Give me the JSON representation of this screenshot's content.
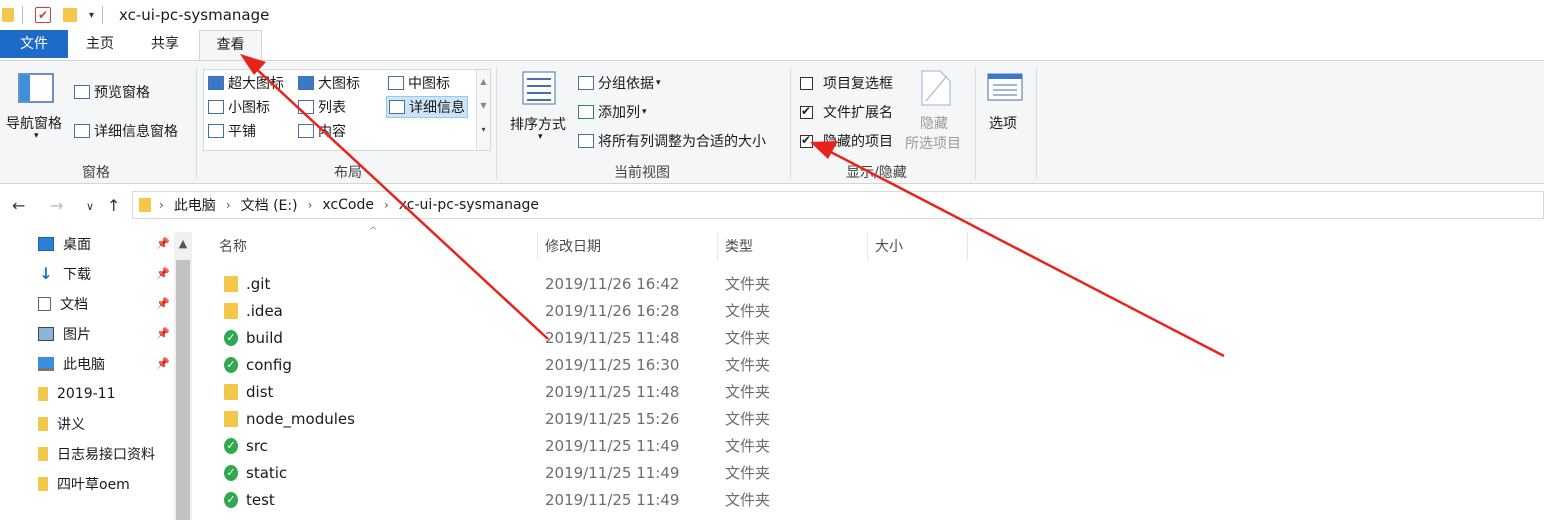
{
  "window": {
    "title": "xc-ui-pc-sysmanage"
  },
  "tabs": {
    "file": "文件",
    "home": "主页",
    "share": "共享",
    "view": "查看"
  },
  "ribbon": {
    "panes": {
      "nav_pane": "导航窗格",
      "preview_pane": "预览窗格",
      "details_pane": "详细信息窗格",
      "group_label": "窗格"
    },
    "layout": {
      "extra_large": "超大图标",
      "large": "大图标",
      "medium": "中图标",
      "small": "小图标",
      "list": "列表",
      "details": "详细信息",
      "tiles": "平铺",
      "content": "内容",
      "group_label": "布局"
    },
    "current_view": {
      "sort_by": "排序方式",
      "group_by": "分组依据",
      "add_columns": "添加列",
      "size_all_columns": "将所有列调整为合适的大小",
      "group_label": "当前视图"
    },
    "show_hide": {
      "item_checkboxes": "项目复选框",
      "item_checkboxes_checked": false,
      "file_extensions": "文件扩展名",
      "file_extensions_checked": true,
      "hidden_items": "隐藏的项目",
      "hidden_items_checked": true,
      "hide_selected_line1": "隐藏",
      "hide_selected_line2": "所选项目",
      "group_label": "显示/隐藏"
    },
    "options": "选项"
  },
  "address": {
    "crumbs": [
      "此电脑",
      "文档 (E:)",
      "xcCode",
      "xc-ui-pc-sysmanage"
    ]
  },
  "sidebar": {
    "items": [
      {
        "label": "桌面",
        "icon": "desktop-icon",
        "pinned": true
      },
      {
        "label": "下载",
        "icon": "download-icon",
        "pinned": true
      },
      {
        "label": "文档",
        "icon": "document-icon",
        "pinned": true
      },
      {
        "label": "图片",
        "icon": "picture-icon",
        "pinned": true
      },
      {
        "label": "此电脑",
        "icon": "computer-icon",
        "pinned": true
      },
      {
        "label": "2019-11",
        "icon": "folder-icon",
        "pinned": false
      },
      {
        "label": "讲义",
        "icon": "folder-icon",
        "pinned": false
      },
      {
        "label": "日志易接口资料",
        "icon": "folder-icon",
        "pinned": false
      },
      {
        "label": "四叶草oem",
        "icon": "folder-icon",
        "pinned": false
      }
    ]
  },
  "filelist": {
    "columns": {
      "name": "名称",
      "modified": "修改日期",
      "type": "类型",
      "size": "大小"
    },
    "rows": [
      {
        "name": ".git",
        "date": "2019/11/26 16:42",
        "type": "文件夹",
        "icon": "folder-icon"
      },
      {
        "name": ".idea",
        "date": "2019/11/26 16:28",
        "type": "文件夹",
        "icon": "folder-icon"
      },
      {
        "name": "build",
        "date": "2019/11/25 11:48",
        "type": "文件夹",
        "icon": "git-synced-folder-icon"
      },
      {
        "name": "config",
        "date": "2019/11/25 16:30",
        "type": "文件夹",
        "icon": "git-synced-folder-icon"
      },
      {
        "name": "dist",
        "date": "2019/11/25 11:48",
        "type": "文件夹",
        "icon": "folder-icon"
      },
      {
        "name": "node_modules",
        "date": "2019/11/25 15:26",
        "type": "文件夹",
        "icon": "folder-icon"
      },
      {
        "name": "src",
        "date": "2019/11/25 11:49",
        "type": "文件夹",
        "icon": "git-synced-folder-icon"
      },
      {
        "name": "static",
        "date": "2019/11/25 11:49",
        "type": "文件夹",
        "icon": "git-synced-folder-icon"
      },
      {
        "name": "test",
        "date": "2019/11/25 11:49",
        "type": "文件夹",
        "icon": "git-synced-folder-icon"
      }
    ]
  },
  "colors": {
    "file_tab": "#1e6ac9",
    "arrow": "#e8231c",
    "folder": "#f3c84a",
    "git_ok": "#2fa84f"
  }
}
